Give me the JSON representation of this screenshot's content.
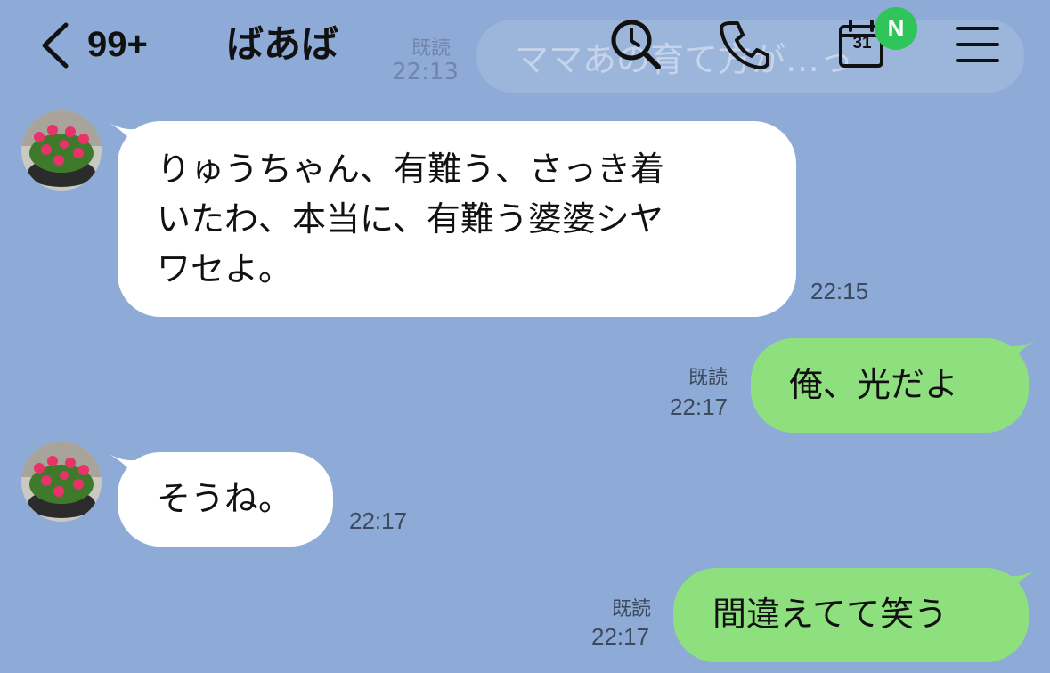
{
  "header": {
    "unread_count": "99+",
    "chat_name": "ばあば",
    "calendar_day": "31",
    "new_badge": "N",
    "background_preview_text": "ママあの育て方が…っ",
    "background_preview_read": "既読",
    "background_preview_time": "22:13",
    "icons": [
      "back-chevron-icon",
      "search-icon",
      "phone-icon",
      "calendar-icon",
      "menu-icon"
    ]
  },
  "messages": [
    {
      "sender": "ばあば",
      "direction": "incoming",
      "lines": [
        "りゅうちゃん、有難う、さっき着",
        "いたわ、本当に、有難う婆婆シヤ",
        "ワセよ。"
      ],
      "time": "22:15"
    },
    {
      "direction": "outgoing",
      "text": "俺、光だよ",
      "read": "既読",
      "time": "22:17"
    },
    {
      "sender": "ばあば",
      "direction": "incoming",
      "text": "そうね。",
      "time": "22:17"
    },
    {
      "direction": "outgoing",
      "text": "間違えてて笑う",
      "read": "既読",
      "time": "22:17"
    }
  ],
  "colors": {
    "background": "#8eaad6",
    "incoming_bubble": "#ffffff",
    "outgoing_bubble": "#8ee07e",
    "badge": "#2fc55a"
  }
}
